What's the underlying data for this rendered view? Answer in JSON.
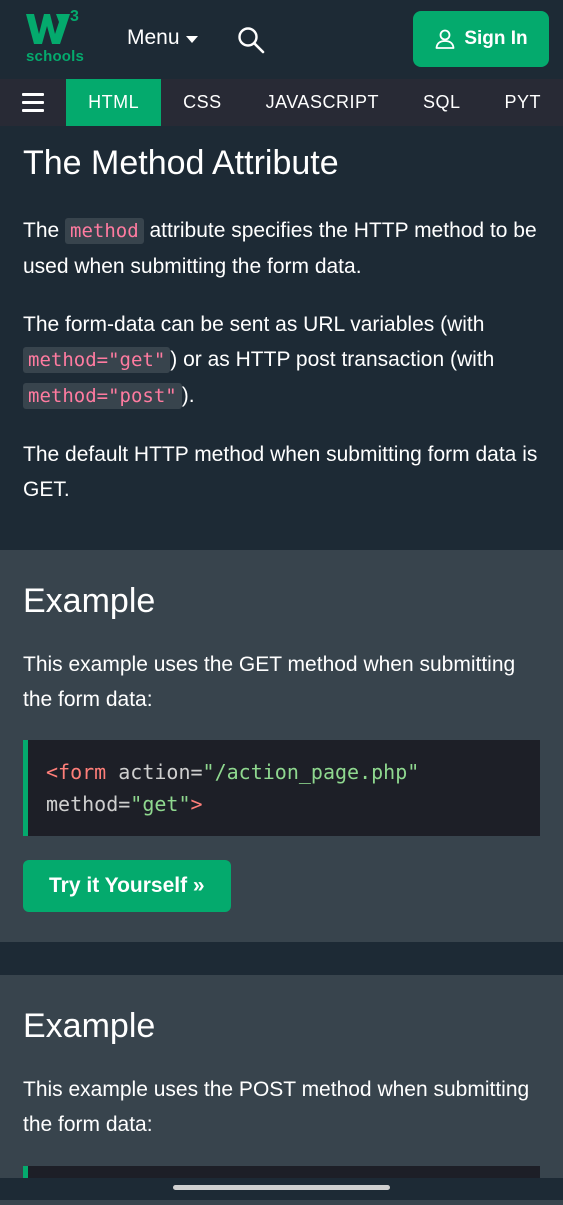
{
  "header": {
    "logo_sup": "3",
    "logo_text": "schools",
    "menu_label": "Menu",
    "signin_label": "Sign In"
  },
  "nav": {
    "tabs": [
      {
        "label": "HTML",
        "active": true
      },
      {
        "label": "CSS"
      },
      {
        "label": "JAVASCRIPT"
      },
      {
        "label": "SQL"
      },
      {
        "label": "PYT"
      }
    ]
  },
  "section": {
    "title": "The Method Attribute",
    "p1_before": "The ",
    "p1_code": "method",
    "p1_after": " attribute specifies the HTTP method to be used when submitting the form data.",
    "p2_a": "The form-data can be sent as URL variables (with ",
    "p2_code1": "method=\"get\"",
    "p2_b": ") or as HTTP post transaction (with ",
    "p2_code2": "method=\"post\"",
    "p2_c": ").",
    "p3": "The default HTTP method when submitting form data is GET."
  },
  "example1": {
    "heading": "Example",
    "desc": "This example uses the GET method when submitting the form data:",
    "code_tag_open": "<form",
    "code_attr1": " action=",
    "code_val1": "\"/action_page.php\"",
    "code_attr2": "method=",
    "code_val2": "\"get\"",
    "code_close": ">",
    "try_label": "Try it Yourself »"
  },
  "example2": {
    "heading": "Example",
    "desc": "This example uses the POST method when submitting the form data:"
  },
  "colors": {
    "accent": "#04aa6d",
    "bg_dark": "#1d2a35",
    "bg_example": "#38444d",
    "code_pink": "#ff7ba0"
  }
}
